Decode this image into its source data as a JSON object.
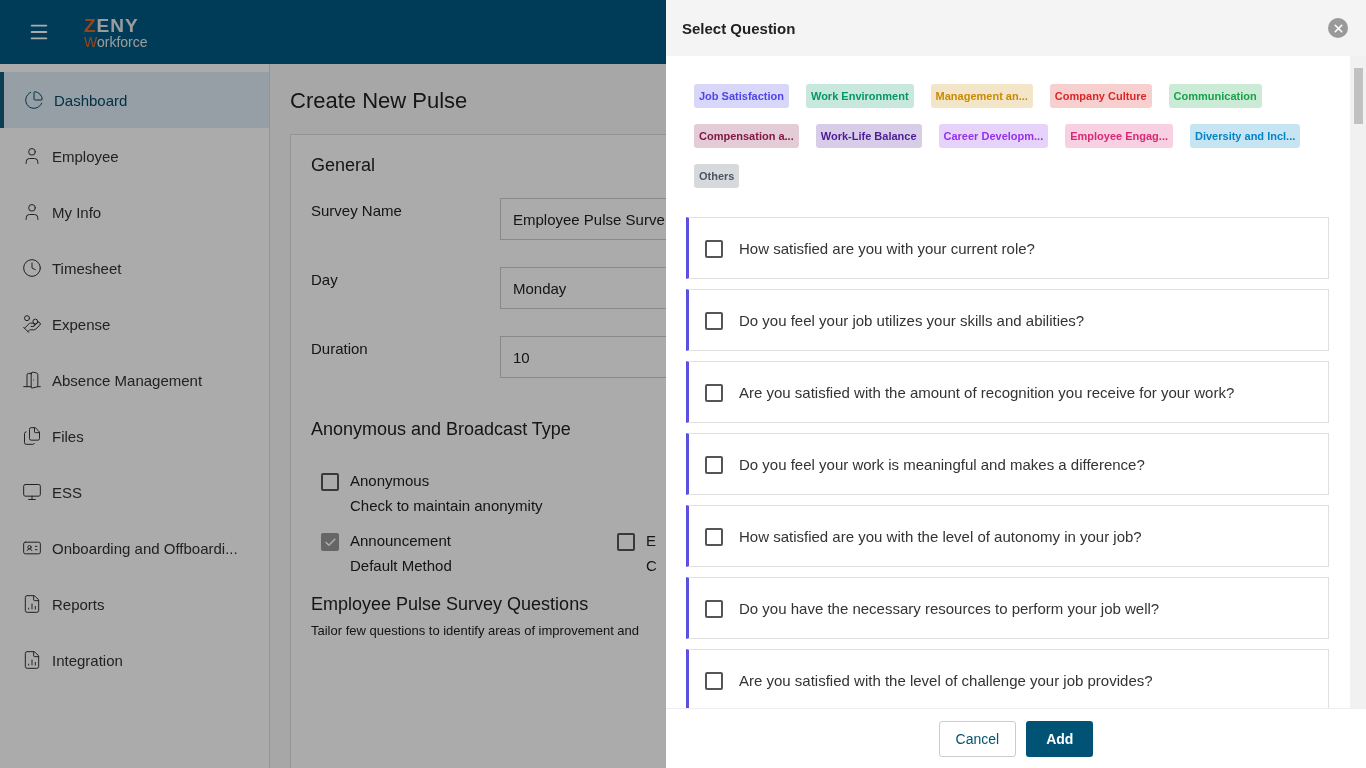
{
  "header": {
    "logo": {
      "top": "ZENY",
      "bottom": "Workforce"
    }
  },
  "sidebar": {
    "items": [
      {
        "label": "Dashboard",
        "selected": true
      },
      {
        "label": "Employee",
        "selected": false
      },
      {
        "label": "My Info",
        "selected": false
      },
      {
        "label": "Timesheet",
        "selected": false
      },
      {
        "label": "Expense",
        "selected": false
      },
      {
        "label": "Absence Management",
        "selected": false
      },
      {
        "label": "Files",
        "selected": false
      },
      {
        "label": "ESS",
        "selected": false
      },
      {
        "label": "Onboarding and Offboardi...",
        "selected": false
      },
      {
        "label": "Reports",
        "selected": false
      },
      {
        "label": "Integration",
        "selected": false
      }
    ]
  },
  "page": {
    "title": "Create New Pulse",
    "general": {
      "heading": "General",
      "fields": [
        {
          "label": "Survey Name",
          "value": "Employee Pulse Surve"
        },
        {
          "label": "Day",
          "value": "Monday"
        },
        {
          "label": "Duration",
          "value": "10"
        }
      ]
    },
    "broadcast": {
      "heading": "Anonymous and Broadcast Type",
      "options": [
        {
          "label": "Anonymous",
          "hint": "Check to maintain anonymity",
          "checked": false,
          "disabled": false
        },
        {
          "label": "Announcement",
          "hint": "Default Method",
          "checked": true,
          "disabled": true
        },
        {
          "label": "E",
          "hint": "C",
          "checked": false,
          "disabled": false
        }
      ]
    },
    "questions": {
      "heading": "Employee Pulse Survey Questions",
      "description": "Tailor few questions to identify areas of improvement and"
    }
  },
  "dialog": {
    "title": "Select Question",
    "tags": [
      {
        "label": "Job Satisfaction",
        "color": "#4f46e5"
      },
      {
        "label": "Work Environment",
        "color": "#059669"
      },
      {
        "label": "Management an...",
        "color": "#ca8a04"
      },
      {
        "label": "Company Culture",
        "color": "#dc2626"
      },
      {
        "label": "Communication",
        "color": "#16a34a"
      },
      {
        "label": "Compensation a...",
        "color": "#831843"
      },
      {
        "label": "Work-Life Balance",
        "color": "#4c1d95"
      },
      {
        "label": "Career Developm...",
        "color": "#9333ea"
      },
      {
        "label": "Employee Engag...",
        "color": "#db2777"
      },
      {
        "label": "Diversity and Incl...",
        "color": "#0284c7"
      },
      {
        "label": "Others",
        "color": "#4b5563"
      }
    ],
    "questions": [
      {
        "text": "How satisfied are you with your current role?",
        "checked": false
      },
      {
        "text": "Do you feel your job utilizes your skills and abilities?",
        "checked": false
      },
      {
        "text": "Are you satisfied with the amount of recognition you receive for your work?",
        "checked": false
      },
      {
        "text": "Do you feel your work is meaningful and makes a difference?",
        "checked": false
      },
      {
        "text": "How satisfied are you with the level of autonomy in your job?",
        "checked": false
      },
      {
        "text": "Do you have the necessary resources to perform your job well?",
        "checked": false
      },
      {
        "text": "Are you satisfied with the level of challenge your job provides?",
        "checked": false
      }
    ],
    "buttons": [
      {
        "label": "Cancel",
        "kind": "secondary"
      },
      {
        "label": "Add",
        "kind": "primary"
      }
    ]
  }
}
